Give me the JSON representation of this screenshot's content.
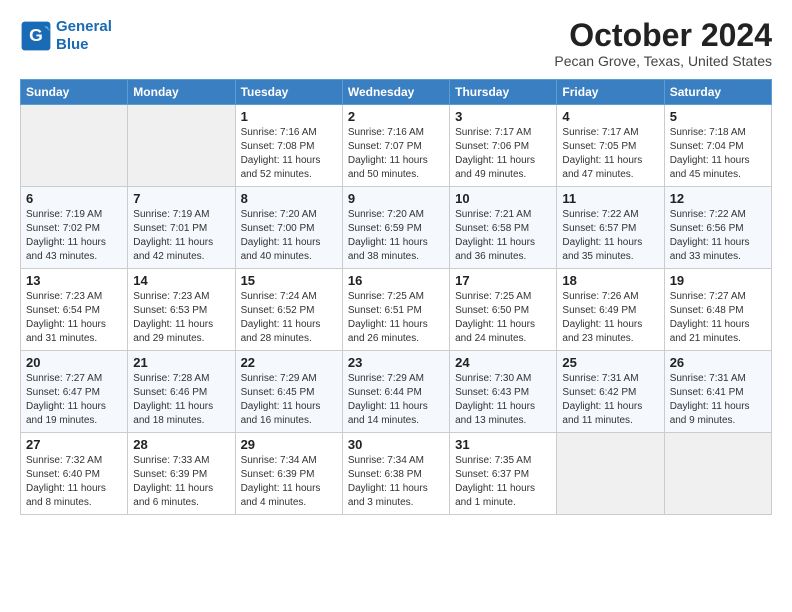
{
  "logo": {
    "line1": "General",
    "line2": "Blue"
  },
  "title": "October 2024",
  "location": "Pecan Grove, Texas, United States",
  "weekdays": [
    "Sunday",
    "Monday",
    "Tuesday",
    "Wednesday",
    "Thursday",
    "Friday",
    "Saturday"
  ],
  "weeks": [
    [
      {
        "day": "",
        "sunrise": "",
        "sunset": "",
        "daylight": ""
      },
      {
        "day": "",
        "sunrise": "",
        "sunset": "",
        "daylight": ""
      },
      {
        "day": "1",
        "sunrise": "Sunrise: 7:16 AM",
        "sunset": "Sunset: 7:08 PM",
        "daylight": "Daylight: 11 hours and 52 minutes."
      },
      {
        "day": "2",
        "sunrise": "Sunrise: 7:16 AM",
        "sunset": "Sunset: 7:07 PM",
        "daylight": "Daylight: 11 hours and 50 minutes."
      },
      {
        "day": "3",
        "sunrise": "Sunrise: 7:17 AM",
        "sunset": "Sunset: 7:06 PM",
        "daylight": "Daylight: 11 hours and 49 minutes."
      },
      {
        "day": "4",
        "sunrise": "Sunrise: 7:17 AM",
        "sunset": "Sunset: 7:05 PM",
        "daylight": "Daylight: 11 hours and 47 minutes."
      },
      {
        "day": "5",
        "sunrise": "Sunrise: 7:18 AM",
        "sunset": "Sunset: 7:04 PM",
        "daylight": "Daylight: 11 hours and 45 minutes."
      }
    ],
    [
      {
        "day": "6",
        "sunrise": "Sunrise: 7:19 AM",
        "sunset": "Sunset: 7:02 PM",
        "daylight": "Daylight: 11 hours and 43 minutes."
      },
      {
        "day": "7",
        "sunrise": "Sunrise: 7:19 AM",
        "sunset": "Sunset: 7:01 PM",
        "daylight": "Daylight: 11 hours and 42 minutes."
      },
      {
        "day": "8",
        "sunrise": "Sunrise: 7:20 AM",
        "sunset": "Sunset: 7:00 PM",
        "daylight": "Daylight: 11 hours and 40 minutes."
      },
      {
        "day": "9",
        "sunrise": "Sunrise: 7:20 AM",
        "sunset": "Sunset: 6:59 PM",
        "daylight": "Daylight: 11 hours and 38 minutes."
      },
      {
        "day": "10",
        "sunrise": "Sunrise: 7:21 AM",
        "sunset": "Sunset: 6:58 PM",
        "daylight": "Daylight: 11 hours and 36 minutes."
      },
      {
        "day": "11",
        "sunrise": "Sunrise: 7:22 AM",
        "sunset": "Sunset: 6:57 PM",
        "daylight": "Daylight: 11 hours and 35 minutes."
      },
      {
        "day": "12",
        "sunrise": "Sunrise: 7:22 AM",
        "sunset": "Sunset: 6:56 PM",
        "daylight": "Daylight: 11 hours and 33 minutes."
      }
    ],
    [
      {
        "day": "13",
        "sunrise": "Sunrise: 7:23 AM",
        "sunset": "Sunset: 6:54 PM",
        "daylight": "Daylight: 11 hours and 31 minutes."
      },
      {
        "day": "14",
        "sunrise": "Sunrise: 7:23 AM",
        "sunset": "Sunset: 6:53 PM",
        "daylight": "Daylight: 11 hours and 29 minutes."
      },
      {
        "day": "15",
        "sunrise": "Sunrise: 7:24 AM",
        "sunset": "Sunset: 6:52 PM",
        "daylight": "Daylight: 11 hours and 28 minutes."
      },
      {
        "day": "16",
        "sunrise": "Sunrise: 7:25 AM",
        "sunset": "Sunset: 6:51 PM",
        "daylight": "Daylight: 11 hours and 26 minutes."
      },
      {
        "day": "17",
        "sunrise": "Sunrise: 7:25 AM",
        "sunset": "Sunset: 6:50 PM",
        "daylight": "Daylight: 11 hours and 24 minutes."
      },
      {
        "day": "18",
        "sunrise": "Sunrise: 7:26 AM",
        "sunset": "Sunset: 6:49 PM",
        "daylight": "Daylight: 11 hours and 23 minutes."
      },
      {
        "day": "19",
        "sunrise": "Sunrise: 7:27 AM",
        "sunset": "Sunset: 6:48 PM",
        "daylight": "Daylight: 11 hours and 21 minutes."
      }
    ],
    [
      {
        "day": "20",
        "sunrise": "Sunrise: 7:27 AM",
        "sunset": "Sunset: 6:47 PM",
        "daylight": "Daylight: 11 hours and 19 minutes."
      },
      {
        "day": "21",
        "sunrise": "Sunrise: 7:28 AM",
        "sunset": "Sunset: 6:46 PM",
        "daylight": "Daylight: 11 hours and 18 minutes."
      },
      {
        "day": "22",
        "sunrise": "Sunrise: 7:29 AM",
        "sunset": "Sunset: 6:45 PM",
        "daylight": "Daylight: 11 hours and 16 minutes."
      },
      {
        "day": "23",
        "sunrise": "Sunrise: 7:29 AM",
        "sunset": "Sunset: 6:44 PM",
        "daylight": "Daylight: 11 hours and 14 minutes."
      },
      {
        "day": "24",
        "sunrise": "Sunrise: 7:30 AM",
        "sunset": "Sunset: 6:43 PM",
        "daylight": "Daylight: 11 hours and 13 minutes."
      },
      {
        "day": "25",
        "sunrise": "Sunrise: 7:31 AM",
        "sunset": "Sunset: 6:42 PM",
        "daylight": "Daylight: 11 hours and 11 minutes."
      },
      {
        "day": "26",
        "sunrise": "Sunrise: 7:31 AM",
        "sunset": "Sunset: 6:41 PM",
        "daylight": "Daylight: 11 hours and 9 minutes."
      }
    ],
    [
      {
        "day": "27",
        "sunrise": "Sunrise: 7:32 AM",
        "sunset": "Sunset: 6:40 PM",
        "daylight": "Daylight: 11 hours and 8 minutes."
      },
      {
        "day": "28",
        "sunrise": "Sunrise: 7:33 AM",
        "sunset": "Sunset: 6:39 PM",
        "daylight": "Daylight: 11 hours and 6 minutes."
      },
      {
        "day": "29",
        "sunrise": "Sunrise: 7:34 AM",
        "sunset": "Sunset: 6:39 PM",
        "daylight": "Daylight: 11 hours and 4 minutes."
      },
      {
        "day": "30",
        "sunrise": "Sunrise: 7:34 AM",
        "sunset": "Sunset: 6:38 PM",
        "daylight": "Daylight: 11 hours and 3 minutes."
      },
      {
        "day": "31",
        "sunrise": "Sunrise: 7:35 AM",
        "sunset": "Sunset: 6:37 PM",
        "daylight": "Daylight: 11 hours and 1 minute."
      },
      {
        "day": "",
        "sunrise": "",
        "sunset": "",
        "daylight": ""
      },
      {
        "day": "",
        "sunrise": "",
        "sunset": "",
        "daylight": ""
      }
    ]
  ]
}
